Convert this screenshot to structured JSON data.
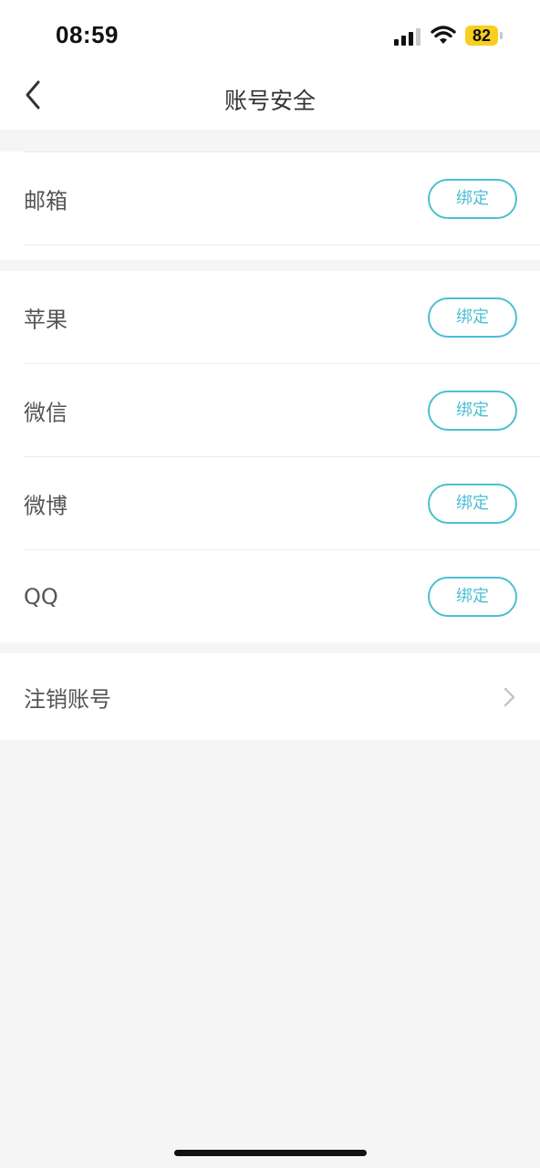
{
  "status_bar": {
    "time": "08:59",
    "battery": "82",
    "battery_color": "#f7cf1f",
    "icons": [
      "signal-icon",
      "wifi-icon",
      "battery-icon"
    ]
  },
  "nav": {
    "title": "账号安全",
    "back_icon": "chevron-left-icon"
  },
  "accent_color": "#4bbfd3",
  "email_group": {
    "items": [
      {
        "label": "邮箱",
        "button": "绑定"
      }
    ]
  },
  "social_group": {
    "items": [
      {
        "label": "苹果",
        "button": "绑定"
      },
      {
        "label": "微信",
        "button": "绑定"
      },
      {
        "label": "微博",
        "button": "绑定"
      },
      {
        "label": "QQ",
        "button": "绑定"
      }
    ]
  },
  "account_group": {
    "cancel_label": "注销账号",
    "cancel_icon": "chevron-right-icon"
  }
}
